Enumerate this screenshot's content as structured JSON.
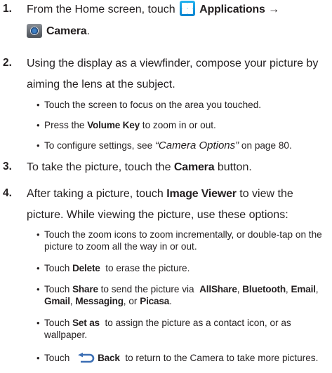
{
  "steps": [
    {
      "num": "1.",
      "lines": {
        "l1_pre": "From the Home screen, touch",
        "l1_bold": "Applications",
        "l1_arrow": "→",
        "l2_bold": "Camera",
        "l2_post": "."
      }
    },
    {
      "num": "2.",
      "line1": "Using the display as a viewfinder, compose your picture by",
      "line2": "aiming the lens at the subject.",
      "bullets": {
        "b1": "Touch the screen to focus on the area you touched.",
        "b2_pre": "Press the ",
        "b2_bold": "Volume Key",
        "b2_post": " to zoom in or out.",
        "b3_pre": "To configure settings, see ",
        "b3_italic": "“Camera Options”",
        "b3_post": " on page 80."
      }
    },
    {
      "num": "3.",
      "pre": "To take the picture, touch the ",
      "bold": "Camera",
      "post": " button."
    },
    {
      "num": "4.",
      "line1_pre": "After taking a picture, touch ",
      "line1_bold": "Image Viewer",
      "line1_post": " to view the",
      "line2": "picture. While viewing the picture, use these options:",
      "bullets": {
        "b1_l1": "Touch the zoom icons to zoom incrementally, or double-tap on the",
        "b1_l2": "picture to zoom all the way in or out.",
        "b2_pre": "Touch ",
        "b2_bold": "Delete",
        "b2_post": "  to erase the picture.",
        "b3_pre": "Touch ",
        "b3_bold1": "Share",
        "b3_mid1": " to send the picture via  ",
        "b3_bold2": "AllShare",
        "b3_sep1": ", ",
        "b3_bold3": "Bluetooth",
        "b3_sep2": ", ",
        "b3_bold4": "Email",
        "b3_sep3": ",",
        "b3_bold5": "Gmail",
        "b3_sep4": ", ",
        "b3_bold6": "Messaging",
        "b3_sep5": ", or ",
        "b3_bold7": "Picasa",
        "b3_end": ".",
        "b4_pre": "Touch ",
        "b4_bold": "Set as",
        "b4_l1_post": "  to assign the picture as a contact icon, or as",
        "b4_l2": "wallpaper.",
        "b5_pre": "Touch ",
        "b5_bold": "Back",
        "b5_post": "  to return to the Camera to take more pictures."
      }
    }
  ],
  "bullet_char": "•",
  "icons": {
    "applications": "applications-icon",
    "camera": "camera-icon",
    "back": "back-arrow-icon"
  },
  "colors": {
    "text": "#231f20",
    "applications_icon": "#0d84cf",
    "back_arrow": "#3c6fb4"
  }
}
